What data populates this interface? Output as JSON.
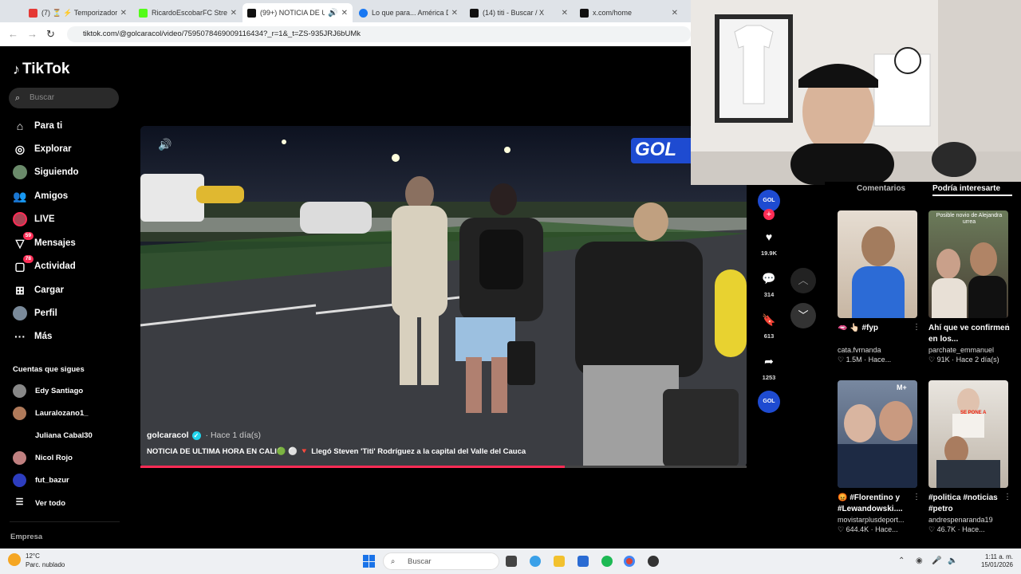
{
  "browser": {
    "tabs": [
      {
        "title": "(7) ⏳ ⚡ Temporizador d",
        "fav": "#e53935"
      },
      {
        "title": "RicardoEscobarFC Stream",
        "fav": "#53fc18"
      },
      {
        "title": "(99+) NOTICIA DE ULT",
        "fav": "#111111"
      },
      {
        "title": "Lo que para... América D",
        "fav": "#1877f2"
      },
      {
        "title": "(14) titi - Buscar / X",
        "fav": "#111111"
      },
      {
        "title": "x.com/home",
        "fav": "#111111"
      }
    ],
    "url": "tiktok.com/@golcaracol/video/7595078469009116434?_r=1&_t=ZS-935JRJ6bUMk"
  },
  "sidebar": {
    "logo": "TikTok",
    "search_placeholder": "Buscar",
    "nav": [
      {
        "label": "Para ti",
        "icon": "home-icon"
      },
      {
        "label": "Explorar",
        "icon": "compass-icon"
      },
      {
        "label": "Siguiendo",
        "icon": "following-icon"
      },
      {
        "label": "Amigos",
        "icon": "friends-icon"
      },
      {
        "label": "LIVE",
        "icon": "live-icon"
      },
      {
        "label": "Mensajes",
        "icon": "messages-icon",
        "badge": "59"
      },
      {
        "label": "Actividad",
        "icon": "activity-icon",
        "badge": "78"
      },
      {
        "label": "Cargar",
        "icon": "upload-icon"
      },
      {
        "label": "Perfil",
        "icon": "profile-icon"
      },
      {
        "label": "Más",
        "icon": "more-icon"
      }
    ],
    "following_title": "Cuentas que sigues",
    "accounts": [
      {
        "name": "Edy Santiago",
        "color": "#888"
      },
      {
        "name": "Lauralozano1_",
        "color": "#b07a5a"
      },
      {
        "name": "Juliana Cabal30",
        "color": "#000"
      },
      {
        "name": "Nicol Rojo",
        "color": "#c08080"
      },
      {
        "name": "fut_bazur",
        "color": "#2d3dbf"
      }
    ],
    "see_all": "Ver todo",
    "empresa": "Empresa"
  },
  "video": {
    "author": "golcaracol",
    "time": "· Hace 1 día(s)",
    "caption": "NOTICIA DE ULTIMA HORA EN CALI🟢 ⚪ 🔻 Llegó Steven 'Titi' Rodríguez a la capital del Valle del Cauca",
    "overlay_brand": "GOL",
    "progress": 0.7
  },
  "actions": {
    "likes": "19.9K",
    "comments": "314",
    "saves": "613",
    "shares": "1253"
  },
  "right_panel": {
    "tabs": [
      "Comentarios",
      "Podría interesarte"
    ],
    "cards": [
      {
        "title": "🫦 👆🏻 #fyp",
        "user": "cata.fvrnanda",
        "stats": "♡ 1.5M · Hace...",
        "bg": "#c9b8a6"
      },
      {
        "title": "Ahí que ve confirmen en los...",
        "user": "parchate_emmanuel",
        "stats": "♡ 91K · Hace 2 día(s)",
        "bg": "#7a6a58",
        "overlay": "Posible novio de Alejandra urrea"
      },
      {
        "title": "😡 #Florentino y #Lewandowski....",
        "user": "movistarplusdeport...",
        "stats": "♡ 644.4K · Hace...",
        "bg": "#5b6e8a"
      },
      {
        "title": "#politica #noticias #petro",
        "user": "andrespenaranda19",
        "stats": "♡ 46.7K · Hace...",
        "bg": "#d8d4cf",
        "overlay": "SE PONE A"
      }
    ]
  },
  "taskbar": {
    "weather_temp": "12°C",
    "weather_desc": "Parc. nublado",
    "search": "Buscar",
    "time": "1:11 a. m.",
    "date": "15/01/2026"
  }
}
